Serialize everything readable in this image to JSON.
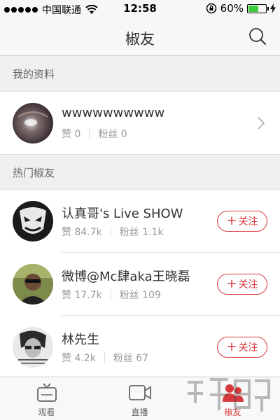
{
  "status_bar": {
    "carrier": "中国联通",
    "time": "12:58",
    "battery_percent": "60%",
    "battery_level": 0.6
  },
  "nav": {
    "title": "椒友",
    "search_icon": "search-icon"
  },
  "my_profile": {
    "section_title": "我的资料",
    "name": "wwwwwwwwww",
    "likes": "赞 0",
    "fans": "粉丝 0"
  },
  "hot": {
    "section_title": "热门椒友",
    "follow_label": "关注",
    "users": [
      {
        "name": "认真哥's Live SHOW",
        "likes": "赞 84.7k",
        "fans": "粉丝 1.1k"
      },
      {
        "name": "微博@Mc肆aka王晓磊",
        "likes": "赞 17.7k",
        "fans": "粉丝 109"
      },
      {
        "name": "林先生",
        "likes": "赞 4.2k",
        "fans": "粉丝 67"
      }
    ]
  },
  "tabs": [
    {
      "label": "观看",
      "icon": "tv-icon"
    },
    {
      "label": "直播",
      "icon": "video-camera-icon"
    },
    {
      "label": "椒友",
      "icon": "friends-icon",
      "active": true
    }
  ],
  "colors": {
    "accent": "#d9383c",
    "battery": "#3ccb3c"
  }
}
